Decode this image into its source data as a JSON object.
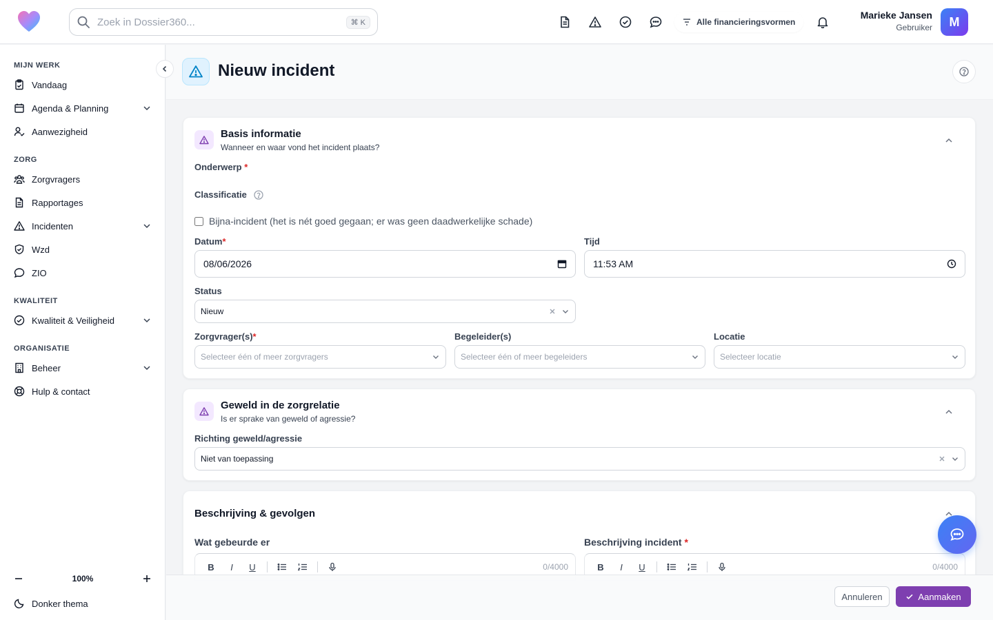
{
  "topbar": {
    "search_placeholder": "Zoek in Dossier360...",
    "search_shortcut": "⌘ K",
    "financing_filter": "Alle financieringsvormen",
    "user_name": "Marieke Jansen",
    "user_role": "Gebruiker",
    "avatar_initial": "M"
  },
  "sidebar": {
    "sections": {
      "mijn_werk": "MIJN WERK",
      "zorg": "ZORG",
      "kwaliteit": "KWALITEIT",
      "organisatie": "ORGANISATIE"
    },
    "items": {
      "vandaag": "Vandaag",
      "agenda": "Agenda & Planning",
      "aanwezigheid": "Aanwezigheid",
      "zorgvragers": "Zorgvragers",
      "rapportages": "Rapportages",
      "incidenten": "Incidenten",
      "wzd": "Wzd",
      "zio": "ZIO",
      "kwaliteit_veiligheid": "Kwaliteit & Veiligheid",
      "beheer": "Beheer",
      "hulp": "Hulp & contact"
    },
    "zoom": "100%",
    "dark_theme": "Donker thema"
  },
  "page": {
    "title": "Nieuw incident"
  },
  "basis": {
    "title": "Basis informatie",
    "subtitle": "Wanneer en waar vond het incident plaats?",
    "onderwerp_label": "Onderwerp",
    "classificatie_label": "Classificatie",
    "bijna_incident_label": "Bijna-incident (het is nét goed gegaan; er was geen daadwerkelijke schade)",
    "bijna_incident_checked": false,
    "datum_label": "Datum",
    "datum_value": "08/06/2026",
    "tijd_label": "Tijd",
    "tijd_value": "11:53 AM",
    "status_label": "Status",
    "status_value": "Nieuw",
    "zorgvragers_label": "Zorgvrager(s)",
    "zorgvragers_placeholder": "Selecteer één of meer zorgvragers",
    "begeleiders_label": "Begeleider(s)",
    "begeleiders_placeholder": "Selecteer één of meer begeleiders",
    "locatie_label": "Locatie",
    "locatie_placeholder": "Selecteer locatie"
  },
  "geweld": {
    "title": "Geweld in de zorgrelatie",
    "subtitle": "Is er sprake van geweld of agressie?",
    "richting_label": "Richting geweld/agressie",
    "richting_value": "Niet van toepassing"
  },
  "beschrijving": {
    "title": "Beschrijving & gevolgen",
    "wat_label": "Wat gebeurde er",
    "wat_counter": "0/4000",
    "incident_label": "Beschrijving incident",
    "incident_counter": "0/4000",
    "toolbar": {
      "bold": "B",
      "italic": "I",
      "underline": "U"
    }
  },
  "footer": {
    "cancel": "Annuleren",
    "create": "Aanmaken"
  },
  "colors": {
    "accent": "#7e3fb0",
    "required": "#dc2626",
    "chat_fab": "#3b82f6"
  }
}
